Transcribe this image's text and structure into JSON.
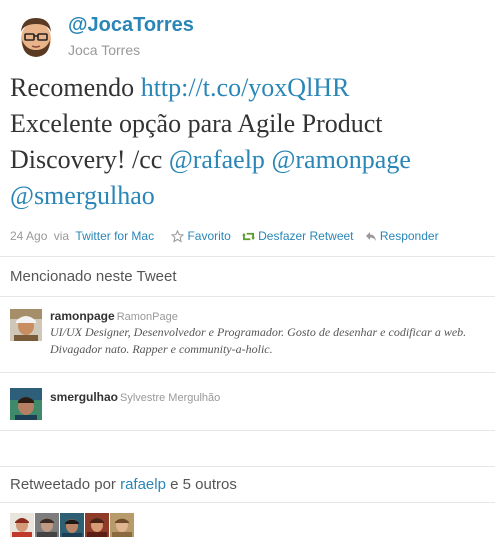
{
  "author": {
    "handle": "@JocaTorres",
    "name": "Joca Torres",
    "avatar_icon": "bearded-man-avatar-icon"
  },
  "tweet": {
    "word_recomendo": "Recomendo",
    "link": "http://t.co/yoxQlHR",
    "line_excelente": "Excelente opção para Agile Product",
    "line_discovery": "Discovery! /cc",
    "mention_1": "@rafaelp",
    "mention_2": "@ramonpage",
    "mention_3": "@smergulhao"
  },
  "meta": {
    "date": "24 Ago",
    "via": "via",
    "source": "Twitter for Mac",
    "favorite": "Favorito",
    "undo_retweet": "Desfazer Retweet",
    "reply": "Responder"
  },
  "mentioned": {
    "heading": "Mencionado neste Tweet",
    "users": [
      {
        "handle": "ramonpage",
        "name": "RamonPage",
        "bio": "UI/UX Designer, Desenvolvedor e Programador. Gosto de desenhar e codificar a web. Divagador nato. Rapper e community-a-holic."
      },
      {
        "handle": "smergulhao",
        "name": "Sylvestre Mergulhão",
        "bio": ""
      }
    ]
  },
  "retweeted": {
    "label": "Retweetado por",
    "user": "rafaelp",
    "others": "e 5 outros"
  },
  "colors": {
    "link": "#2a86b7",
    "retweet_green": "#5a9e2e",
    "muted": "#999999"
  }
}
